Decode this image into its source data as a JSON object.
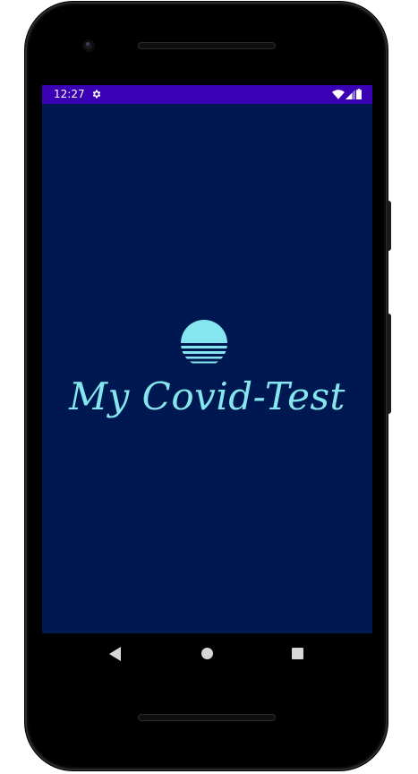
{
  "status_bar": {
    "time": "12:27",
    "background_color": "#3a00b4",
    "icons": [
      "settings-icon",
      "wifi-icon",
      "signal-icon",
      "battery-icon"
    ]
  },
  "splash": {
    "background_color": "#001852",
    "logo_color": "#86e6ef",
    "logo_icon": "sunset-icon",
    "title": "My Covid-Test"
  },
  "navigation_bar": {
    "buttons": [
      "back",
      "home",
      "recents"
    ]
  }
}
